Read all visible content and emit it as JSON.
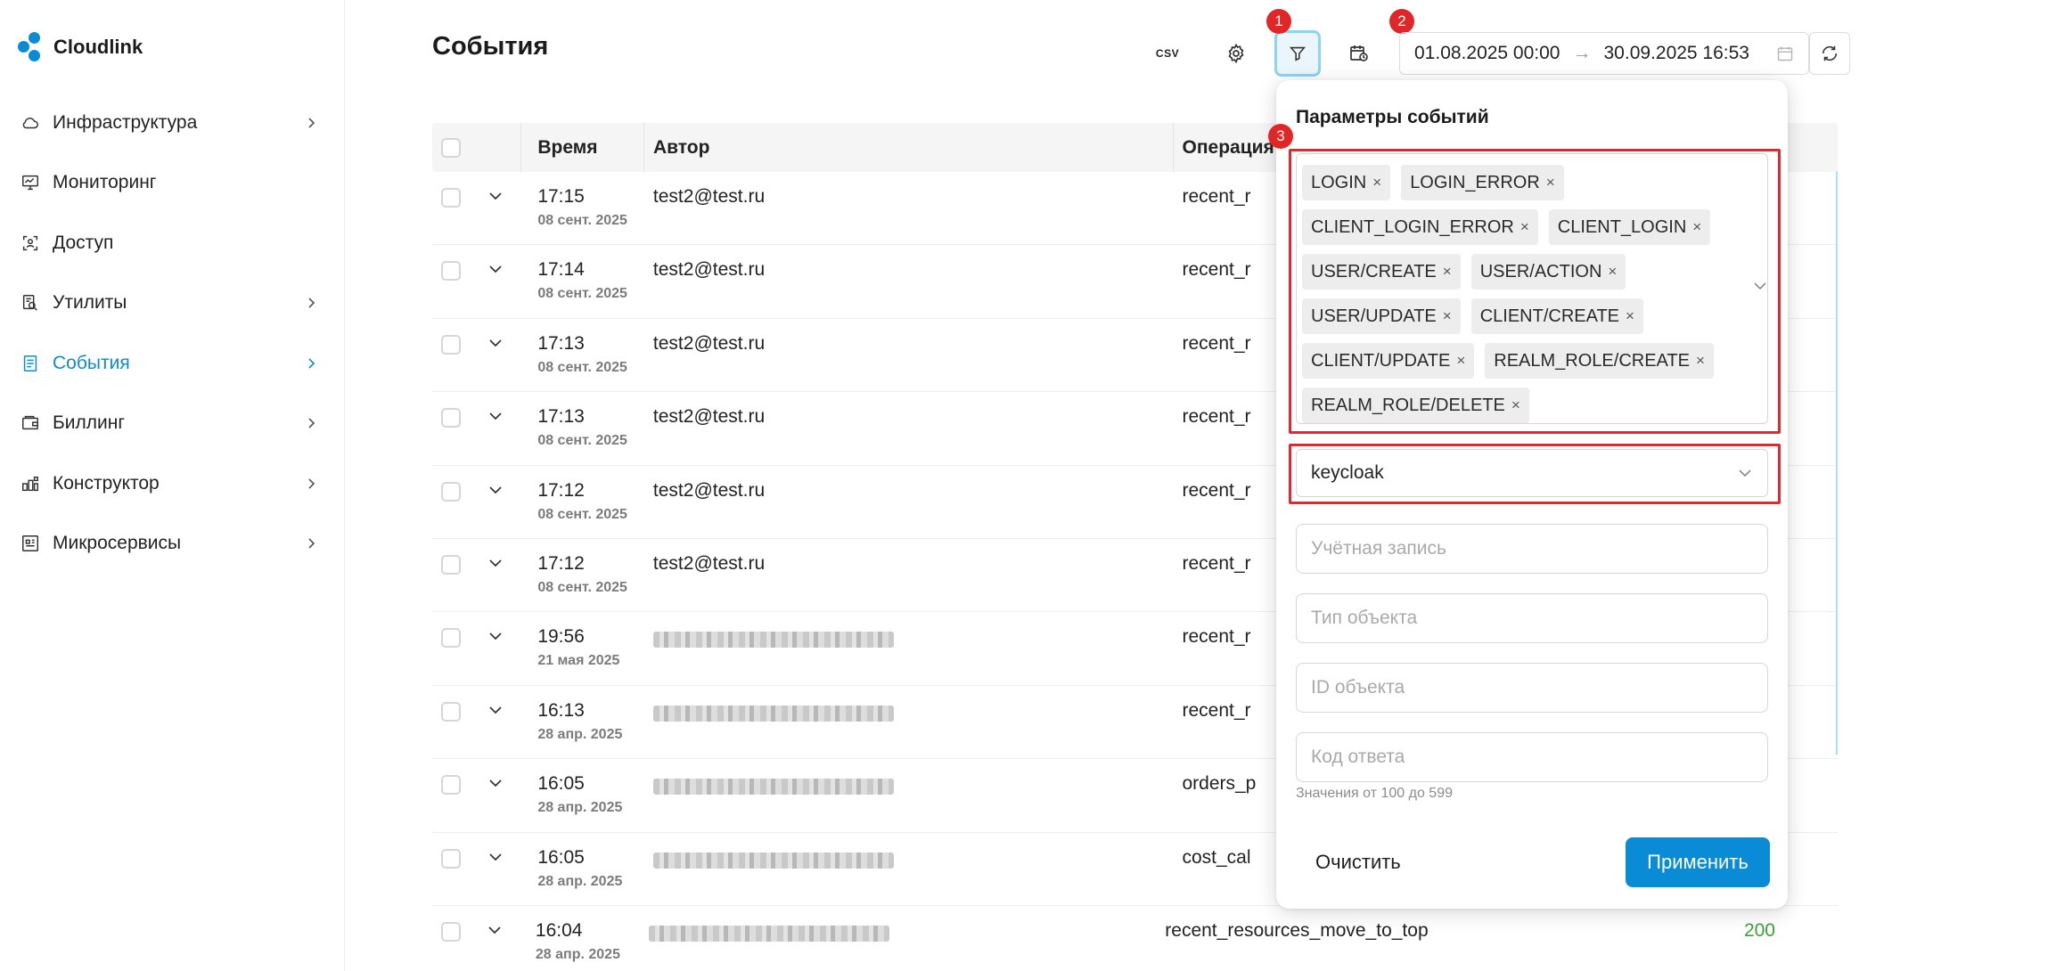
{
  "app": {
    "name": "Cloudlink"
  },
  "sidebar": {
    "items": [
      {
        "label": "Инфраструктура",
        "icon": "cloud-icon",
        "has_chevron": true,
        "active": false
      },
      {
        "label": "Мониторинг",
        "icon": "monitor-icon",
        "has_chevron": false,
        "active": false
      },
      {
        "label": "Доступ",
        "icon": "access-icon",
        "has_chevron": false,
        "active": false
      },
      {
        "label": "Утилиты",
        "icon": "tools-icon",
        "has_chevron": true,
        "active": false
      },
      {
        "label": "События",
        "icon": "events-icon",
        "has_chevron": true,
        "active": true
      },
      {
        "label": "Биллинг",
        "icon": "wallet-icon",
        "has_chevron": true,
        "active": false
      },
      {
        "label": "Конструктор",
        "icon": "constructor-icon",
        "has_chevron": true,
        "active": false
      },
      {
        "label": "Микросервисы",
        "icon": "microservices-icon",
        "has_chevron": true,
        "active": false
      }
    ]
  },
  "header": {
    "title": "События",
    "csv_label": "CSV",
    "badges": {
      "filter": "1",
      "date": "2",
      "popup": "3"
    },
    "date_from": "01.08.2025 00:00",
    "date_to": "30.09.2025 16:53",
    "date_arrow": "→"
  },
  "table": {
    "columns": {
      "time": "Время",
      "author": "Автор",
      "operation": "Операция"
    },
    "rows": [
      {
        "time": "17:15",
        "date": "08 сент. 2025",
        "author": "test2@test.ru",
        "operation": "recent_r",
        "code": ""
      },
      {
        "time": "17:14",
        "date": "08 сент. 2025",
        "author": "test2@test.ru",
        "operation": "recent_r",
        "code": ""
      },
      {
        "time": "17:13",
        "date": "08 сент. 2025",
        "author": "test2@test.ru",
        "operation": "recent_r",
        "code": ""
      },
      {
        "time": "17:13",
        "date": "08 сент. 2025",
        "author": "test2@test.ru",
        "operation": "recent_r",
        "code": ""
      },
      {
        "time": "17:12",
        "date": "08 сент. 2025",
        "author": "test2@test.ru",
        "operation": "recent_r",
        "code": ""
      },
      {
        "time": "17:12",
        "date": "08 сент. 2025",
        "author": "test2@test.ru",
        "operation": "recent_r",
        "code": ""
      },
      {
        "time": "19:56",
        "date": "21 мая 2025",
        "author": "",
        "operation": "recent_r",
        "code": ""
      },
      {
        "time": "16:13",
        "date": "28 апр. 2025",
        "author": "",
        "operation": "recent_r",
        "code": ""
      },
      {
        "time": "16:05",
        "date": "28 апр. 2025",
        "author": "",
        "operation": "orders_p",
        "code": ""
      },
      {
        "time": "16:05",
        "date": "28 апр. 2025",
        "author": "",
        "operation": "cost_cal",
        "code": ""
      },
      {
        "time": "16:04",
        "date": "28 апр. 2025",
        "author": "",
        "operation": "recent_resources_move_to_top",
        "code": "200"
      }
    ]
  },
  "filter_popup": {
    "title": "Параметры событий",
    "event_types": [
      "LOGIN",
      "LOGIN_ERROR",
      "CLIENT_LOGIN_ERROR",
      "CLIENT_LOGIN",
      "USER/CREATE",
      "USER/ACTION",
      "USER/UPDATE",
      "CLIENT/CREATE",
      "CLIENT/UPDATE",
      "REALM_ROLE/CREATE",
      "REALM_ROLE/DELETE"
    ],
    "tag_remove_glyph": "×",
    "source_value": "keycloak",
    "account_placeholder": "Учётная запись",
    "object_type_placeholder": "Тип объекта",
    "object_id_placeholder": "ID объекта",
    "response_code_placeholder": "Код ответа",
    "response_code_hint": "Значения от 100 до 599",
    "clear_label": "Очистить",
    "apply_label": "Применить"
  },
  "colors": {
    "accent": "#0a8bd6",
    "highlight_red": "#e0282e",
    "badge_red": "#e02626",
    "success_green": "#3aa335",
    "filter_active_border": "#8dd3f2"
  }
}
